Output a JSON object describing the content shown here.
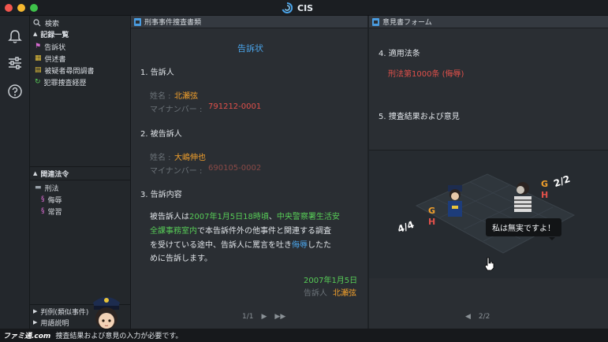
{
  "window": {
    "title": "CIS"
  },
  "sidebar": {
    "search_label": "検索",
    "records_header": "記録一覧",
    "records": [
      {
        "label": "告訴状",
        "icon": "runner-icon"
      },
      {
        "label": "供述書",
        "icon": "statement-icon"
      },
      {
        "label": "被疑者尋問調書",
        "icon": "interrogation-icon"
      },
      {
        "label": "犯罪捜査経歴",
        "icon": "history-icon"
      }
    ],
    "laws_header": "関連法令",
    "laws_folder": "刑法",
    "laws": [
      {
        "label": "侮辱"
      },
      {
        "label": "常習"
      }
    ],
    "bottom_items": [
      {
        "label": "判例(類似事件)"
      },
      {
        "label": "用語説明"
      }
    ]
  },
  "left_panel": {
    "header": "刑事事件捜査書類",
    "doc_title": "告訴状",
    "section1": "1. 告訴人",
    "name_label": "姓名 :",
    "name1": "北瀬弦",
    "mynumber_label": "マイナンバー :",
    "mynumber1": "791212-0001",
    "section2": "2. 被告訴人",
    "name2": "大嶋伸也",
    "mynumber2": "690105-0002",
    "section3": "3. 告訴内容",
    "body": {
      "p1": "被告訴人は",
      "date_time": "2007年1月5日18時頃",
      "p2": "、",
      "place1": "中央警察署生活安",
      "place2": "全課事務室内",
      "p3": "で本告訴件外の他事件と関連する調査",
      "line3": "を受けている途中、告訴人に罵言を吐き",
      "insult": "侮辱",
      "p4": "したた",
      "line4": "めに告訴します。"
    },
    "date": "2007年1月5日",
    "signer_label": "告訴人",
    "signer": "北瀬弦",
    "page": "1/1"
  },
  "right_panel": {
    "header": "意見書フォーム",
    "section4": "4. 適用法条",
    "law_ref": "刑法第1000条 (侮辱)",
    "section5": "5. 捜査結果および意見",
    "speech": "私は無実ですよ！",
    "page": "2/2",
    "labels": {
      "left_fraction": "4/4",
      "right_fraction": "2/2",
      "g": "G",
      "h": "H"
    }
  },
  "status": {
    "text": "捜査結果および意見の入力が必要です。"
  },
  "watermark": "ファミ通.com",
  "colors": {
    "accent_blue": "#4aa3e8",
    "red": "#e0504a",
    "orange": "#f2a02c",
    "green": "#57cc57"
  }
}
